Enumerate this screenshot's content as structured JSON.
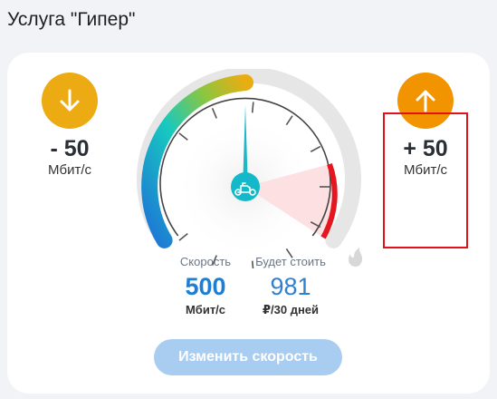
{
  "page": {
    "title": "Услуга \"Гипер\""
  },
  "decrease": {
    "label": "- 50",
    "unit": "Мбит/с",
    "color": "#ecab12",
    "icon": "arrow-down-icon"
  },
  "increase": {
    "label": "+ 50",
    "unit": "Мбит/с",
    "color": "#f29300",
    "icon": "arrow-up-icon"
  },
  "gauge": {
    "center_icon": "scooter-icon",
    "corner_icon": "flame-icon"
  },
  "speed": {
    "label": "Скорость",
    "value": "500",
    "unit": "Мбит/с"
  },
  "cost": {
    "label": "Будет стоить",
    "value": "981",
    "unit": "₽/30 дней"
  },
  "actions": {
    "change_speed_label": "Изменить скорость"
  }
}
